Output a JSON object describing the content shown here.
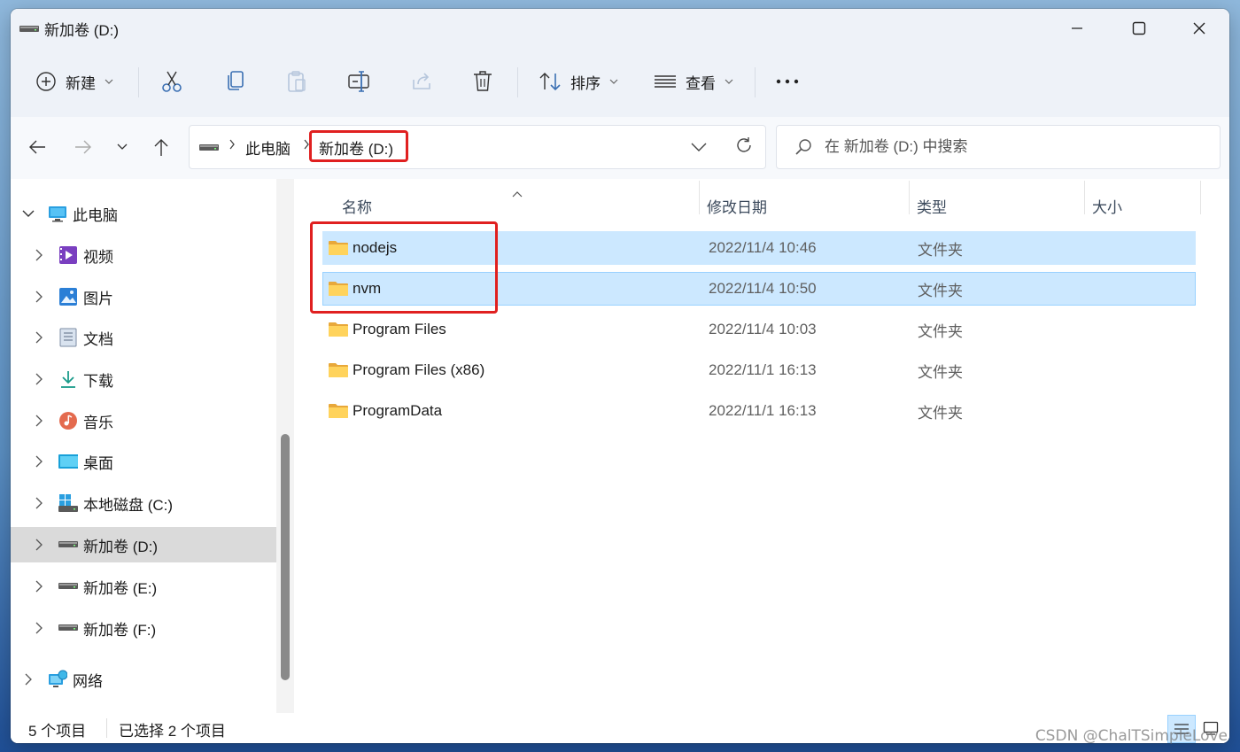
{
  "window": {
    "title": "新加卷 (D:)"
  },
  "toolbar": {
    "new_label": "新建",
    "sort_label": "排序",
    "view_label": "查看"
  },
  "address": {
    "crumb_pc": "此电脑",
    "crumb_drive": "新加卷 (D:)"
  },
  "search": {
    "placeholder": "在 新加卷 (D:) 中搜索"
  },
  "sidebar": {
    "root_label": "此电脑",
    "items": [
      {
        "label": "视频",
        "icon": "video-folder-icon"
      },
      {
        "label": "图片",
        "icon": "pictures-folder-icon"
      },
      {
        "label": "文档",
        "icon": "documents-folder-icon"
      },
      {
        "label": "下载",
        "icon": "downloads-folder-icon"
      },
      {
        "label": "音乐",
        "icon": "music-folder-icon"
      },
      {
        "label": "桌面",
        "icon": "desktop-folder-icon"
      },
      {
        "label": "本地磁盘 (C:)",
        "icon": "system-drive-icon"
      },
      {
        "label": "新加卷 (D:)",
        "icon": "drive-icon"
      },
      {
        "label": "新加卷 (E:)",
        "icon": "drive-icon"
      },
      {
        "label": "新加卷 (F:)",
        "icon": "drive-icon"
      }
    ],
    "network_label": "网络"
  },
  "columns": {
    "name": "名称",
    "date": "修改日期",
    "type": "类型",
    "size": "大小"
  },
  "files": [
    {
      "name": "nodejs",
      "date": "2022/11/4 10:46",
      "type": "文件夹",
      "selected": true
    },
    {
      "name": "nvm",
      "date": "2022/11/4 10:50",
      "type": "文件夹",
      "selected": true
    },
    {
      "name": "Program Files",
      "date": "2022/11/4 10:03",
      "type": "文件夹",
      "selected": false
    },
    {
      "name": "Program Files (x86)",
      "date": "2022/11/1 16:13",
      "type": "文件夹",
      "selected": false
    },
    {
      "name": "ProgramData",
      "date": "2022/11/1 16:13",
      "type": "文件夹",
      "selected": false
    }
  ],
  "status": {
    "count": "5 个项目",
    "selected": "已选择 2 个项目"
  },
  "watermark": "CSDN @ChalTSimpleLove",
  "colors": {
    "selection": "#cce8ff",
    "highlight_box": "#e02020",
    "chrome": "#eef2f8"
  }
}
